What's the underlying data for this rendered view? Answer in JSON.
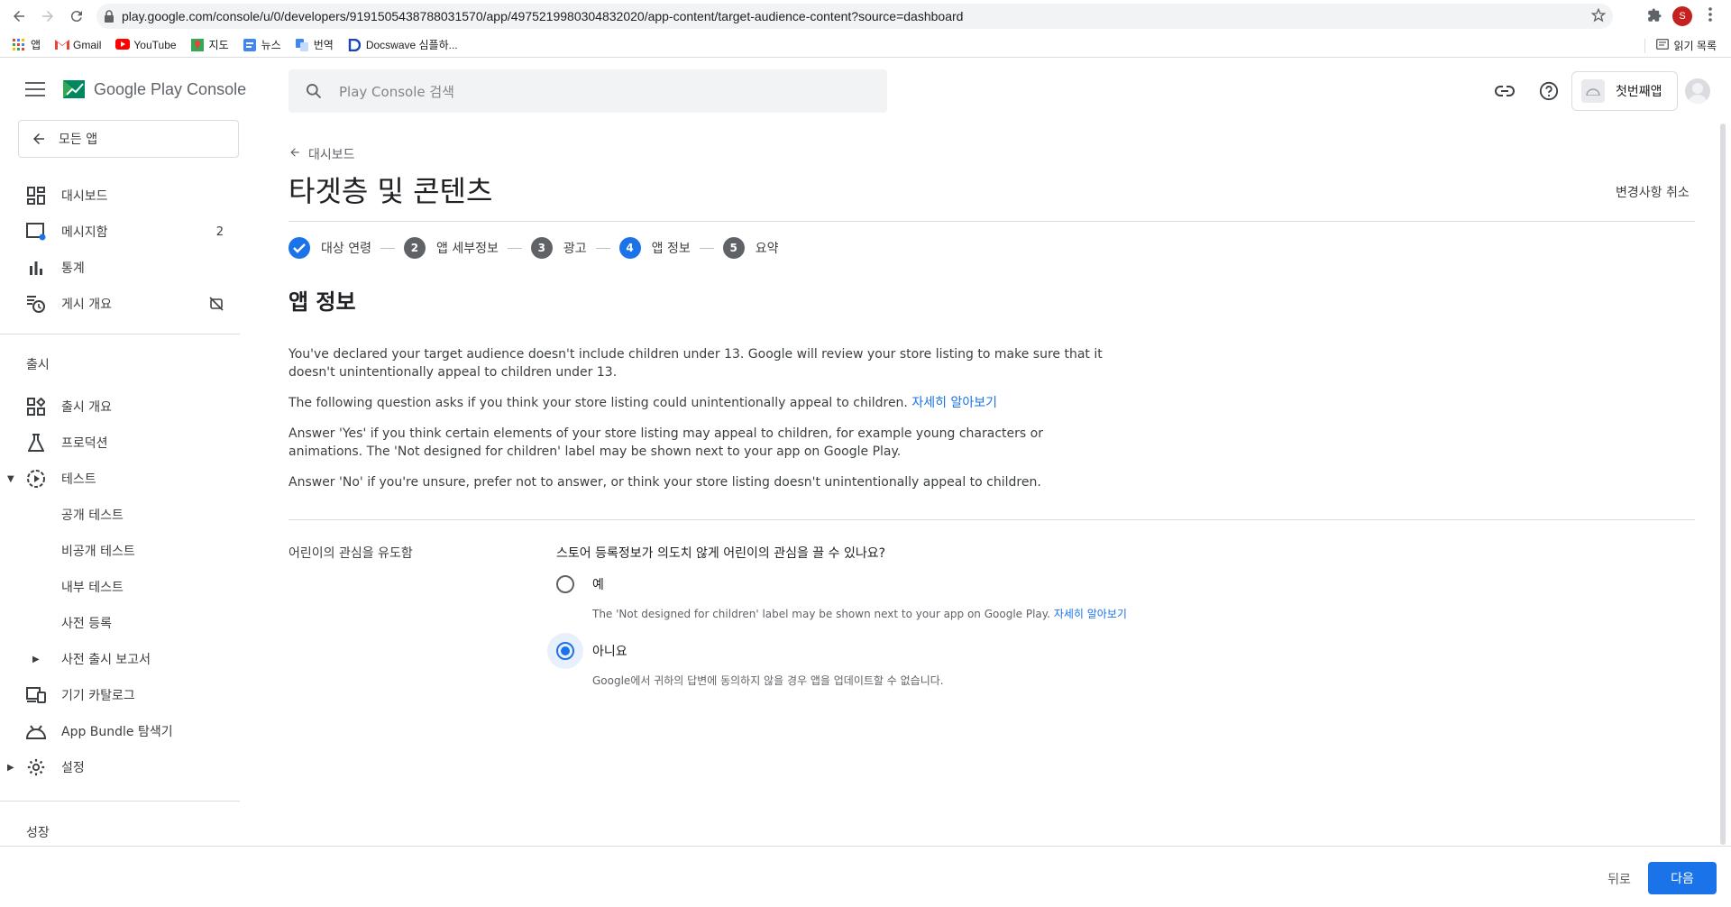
{
  "browser": {
    "url": "play.google.com/console/u/0/developers/9191505438788031570/app/4975219980304832020/app-content/target-audience-content?source=dashboard",
    "profile_initial": "S",
    "bookmarks": [
      {
        "label": "앱",
        "icon": "apps-grid-icon"
      },
      {
        "label": "Gmail",
        "icon": "gmail-icon"
      },
      {
        "label": "YouTube",
        "icon": "youtube-icon"
      },
      {
        "label": "지도",
        "icon": "maps-icon"
      },
      {
        "label": "뉴스",
        "icon": "news-icon"
      },
      {
        "label": "번역",
        "icon": "translate-icon"
      },
      {
        "label": "Docswave 심플하...",
        "icon": "docswave-icon"
      }
    ],
    "reading_list": "읽기 목록"
  },
  "header": {
    "logo_text": "Google Play Console",
    "search_placeholder": "Play Console 검색",
    "app_name": "첫번째앱"
  },
  "sidebar": {
    "all_apps": "모든 앱",
    "items": [
      {
        "label": "대시보드",
        "icon": "dashboard-icon"
      },
      {
        "label": "메시지함",
        "icon": "inbox-icon",
        "badge": "2"
      },
      {
        "label": "통계",
        "icon": "stats-icon"
      },
      {
        "label": "게시 개요",
        "icon": "publish-overview-icon"
      }
    ],
    "release_section": "출시",
    "release_items": [
      {
        "label": "출시 개요",
        "icon": "release-overview-icon"
      },
      {
        "label": "프로덕션",
        "icon": "production-icon"
      },
      {
        "label": "테스트",
        "icon": "testing-icon"
      },
      {
        "label": "공개 테스트"
      },
      {
        "label": "비공개 테스트"
      },
      {
        "label": "내부 테스트"
      },
      {
        "label": "사전 등록"
      },
      {
        "label": "사전 출시 보고서"
      },
      {
        "label": "기기 카탈로그",
        "icon": "device-catalog-icon"
      },
      {
        "label": "App Bundle 탐색기",
        "icon": "app-bundle-icon"
      },
      {
        "label": "설정",
        "icon": "settings-gear-icon"
      }
    ],
    "growth_section": "성장"
  },
  "main": {
    "back_label": "대시보드",
    "title": "타겟층 및 콘텐츠",
    "discard_label": "변경사항 취소",
    "steps": [
      {
        "num": "1",
        "label": "대상 연령",
        "state": "done"
      },
      {
        "num": "2",
        "label": "앱 세부정보",
        "state": "pending"
      },
      {
        "num": "3",
        "label": "광고",
        "state": "pending"
      },
      {
        "num": "4",
        "label": "앱 정보",
        "state": "active"
      },
      {
        "num": "5",
        "label": "요약",
        "state": "pending"
      }
    ],
    "section_heading": "앱 정보",
    "para1": "You've declared your target audience doesn't include children under 13. Google will review your store listing to make sure that it doesn't unintentionally appeal to children under 13.",
    "para2": "The following question asks if you think your store listing could unintentionally appeal to children.",
    "learn_more": "자세히 알아보기",
    "para3": "Answer 'Yes' if you think certain elements of your store listing may appeal to children, for example young characters or animations. The 'Not designed for children' label may be shown next to your app on Google Play.",
    "para4": "Answer 'No' if you're unsure, prefer not to answer, or think your store listing doesn't unintentionally appeal to children.",
    "question_label": "어린이의 관심을 유도함",
    "question": "스토어 등록정보가 의도치 않게 어린이의 관심을 끌 수 있나요?",
    "option_yes": "예",
    "option_yes_desc": "The 'Not designed for children' label may be shown next to your app on Google Play.",
    "option_no": "아니요",
    "option_no_desc": "Google에서 귀하의 답변에 동의하지 않을 경우 앱을 업데이트할 수 없습니다.",
    "selected": "no"
  },
  "footer": {
    "back": "뒤로",
    "next": "다음"
  },
  "colors": {
    "accent": "#1a73e8"
  }
}
